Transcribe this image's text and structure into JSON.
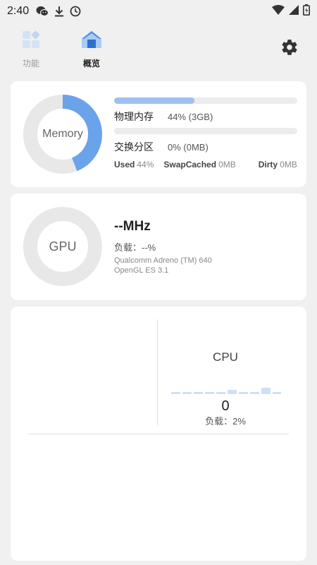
{
  "status_bar": {
    "time": "2:40"
  },
  "nav": {
    "features_label": "功能",
    "overview_label": "概览"
  },
  "memory": {
    "ring_label": "Memory",
    "ring_fraction": 0.44,
    "physical_label": "物理内存",
    "physical_value": "44% (3GB)",
    "physical_fraction": 0.44,
    "swap_label": "交换分区",
    "swap_value": "0% (0MB)",
    "swap_fraction": 0.0,
    "stats": [
      {
        "key": "Used",
        "value": "44%"
      },
      {
        "key": "SwapCached",
        "value": "0MB"
      },
      {
        "key": "Dirty",
        "value": "0MB"
      }
    ]
  },
  "gpu": {
    "ring_label": "GPU",
    "frequency": "--MHz",
    "load": "负载：--%",
    "renderer": "Qualcomm Adreno (TM) 640",
    "api_version": "OpenGL ES 3.1"
  },
  "cpu": {
    "title": "CPU",
    "frequency": "0",
    "load": "负载：2%"
  },
  "colors": {
    "accent": "#6aa3ea",
    "ring_track": "#e8e8e8",
    "bar_fill": "#9ec0f0"
  }
}
